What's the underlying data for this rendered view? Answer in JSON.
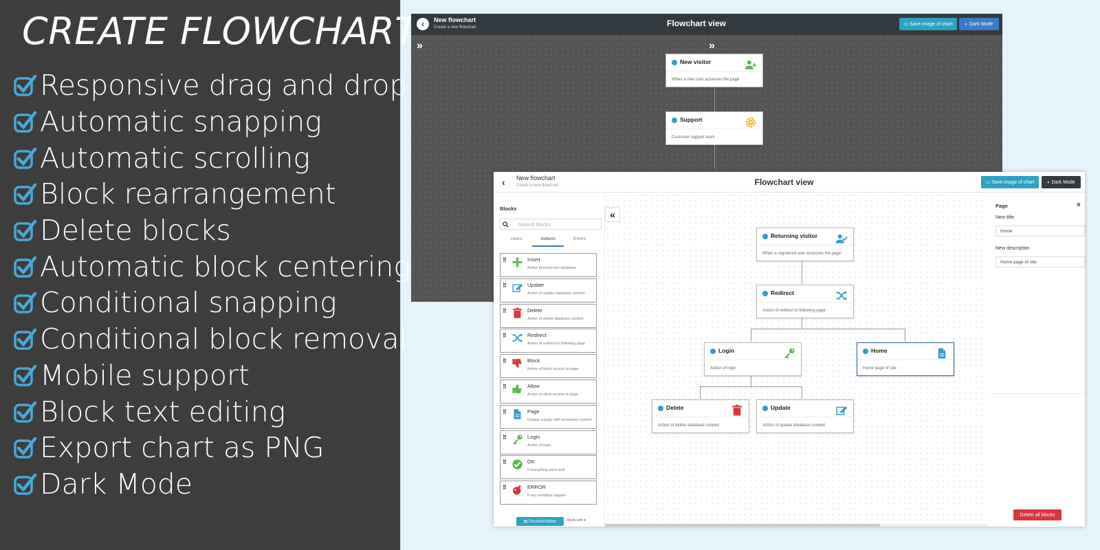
{
  "promo": {
    "title": "CREATE FLOWCHART",
    "features": [
      "Responsive drag and drop",
      "Automatic snapping",
      "Automatic scrolling",
      "Block rearrangement",
      "Delete blocks",
      "Automatic block centering",
      "Conditional snapping",
      "Conditional block removal",
      "Mobile support",
      "Block text editing",
      "Export chart as PNG",
      "Dark Mode"
    ],
    "check_color": "#4aa8d8"
  },
  "dark_app": {
    "title": "New flowchart",
    "subtitle": "Create a new flowchart",
    "view_title": "Flowchart view",
    "save_label": "Save image of chart",
    "mode_label": "Dark Mode",
    "blocks": [
      {
        "title": "New visitor",
        "desc": "When a new user accesses the page",
        "icon": "user-plus-icon"
      },
      {
        "title": "Support",
        "desc": "Customer support team",
        "icon": "gear-icon"
      }
    ]
  },
  "light_app": {
    "title": "New flowchart",
    "subtitle": "Create a new flowchart",
    "view_title": "Flowchart view",
    "save_label": "Save image of chart",
    "mode_label": "Dark Mode",
    "sidebar": {
      "heading": "Blocks",
      "search_placeholder": "Search blocks",
      "tabs": [
        "Users",
        "Actions",
        "Errors"
      ],
      "active_tab": "Actions",
      "items": [
        {
          "title": "Insert",
          "desc": "Action of insert into database",
          "icon": "plus-icon"
        },
        {
          "title": "Update",
          "desc": "Action of update database content",
          "icon": "edit-icon"
        },
        {
          "title": "Delete",
          "desc": "Action of delete database content",
          "icon": "trash-icon"
        },
        {
          "title": "Redirect",
          "desc": "Action of redirect to following page",
          "icon": "shuffle-icon"
        },
        {
          "title": "Block",
          "desc": "Action of block access to page",
          "icon": "thumbs-down-icon"
        },
        {
          "title": "Allow",
          "desc": "Action of allow access to page",
          "icon": "thumbs-up-icon"
        },
        {
          "title": "Page",
          "desc": "Display a page with necessary content",
          "icon": "file-icon"
        },
        {
          "title": "Login",
          "desc": "Action of login",
          "icon": "key-icon"
        },
        {
          "title": "OK",
          "desc": "If everything went well",
          "icon": "check-circle-icon"
        },
        {
          "title": "ERROR",
          "desc": "If any mistakes happen",
          "icon": "bomb-icon"
        }
      ],
      "doc_label": "Documentation",
      "made_with": "Made with"
    },
    "canvas_blocks": [
      {
        "title": "Returning visitor",
        "desc": "When a registered user accesses the page",
        "icon": "user-check-icon"
      },
      {
        "title": "Redirect",
        "desc": "Action of redirect to following page",
        "icon": "shuffle-icon"
      },
      {
        "title": "Login",
        "desc": "Action of login",
        "icon": "key-icon"
      },
      {
        "title": "Home",
        "desc": "Home page of site",
        "icon": "file-icon"
      },
      {
        "title": "Delete",
        "desc": "Action of delete database content",
        "icon": "trash-icon"
      },
      {
        "title": "Update",
        "desc": "Action of update database content",
        "icon": "edit-icon"
      }
    ],
    "properties": {
      "heading": "Page",
      "close": "×",
      "title_label": "New title",
      "title_value": "Home",
      "desc_label": "New description",
      "desc_value": "Home page of site",
      "delete_all_label": "Delete all blocks"
    }
  },
  "colors": {
    "promo_bg": "#3d3d3d",
    "page_bg": "#e6f3fa",
    "accent_teal": "#2ea3c0",
    "danger": "#d9363e",
    "info": "#3a9ac9"
  }
}
